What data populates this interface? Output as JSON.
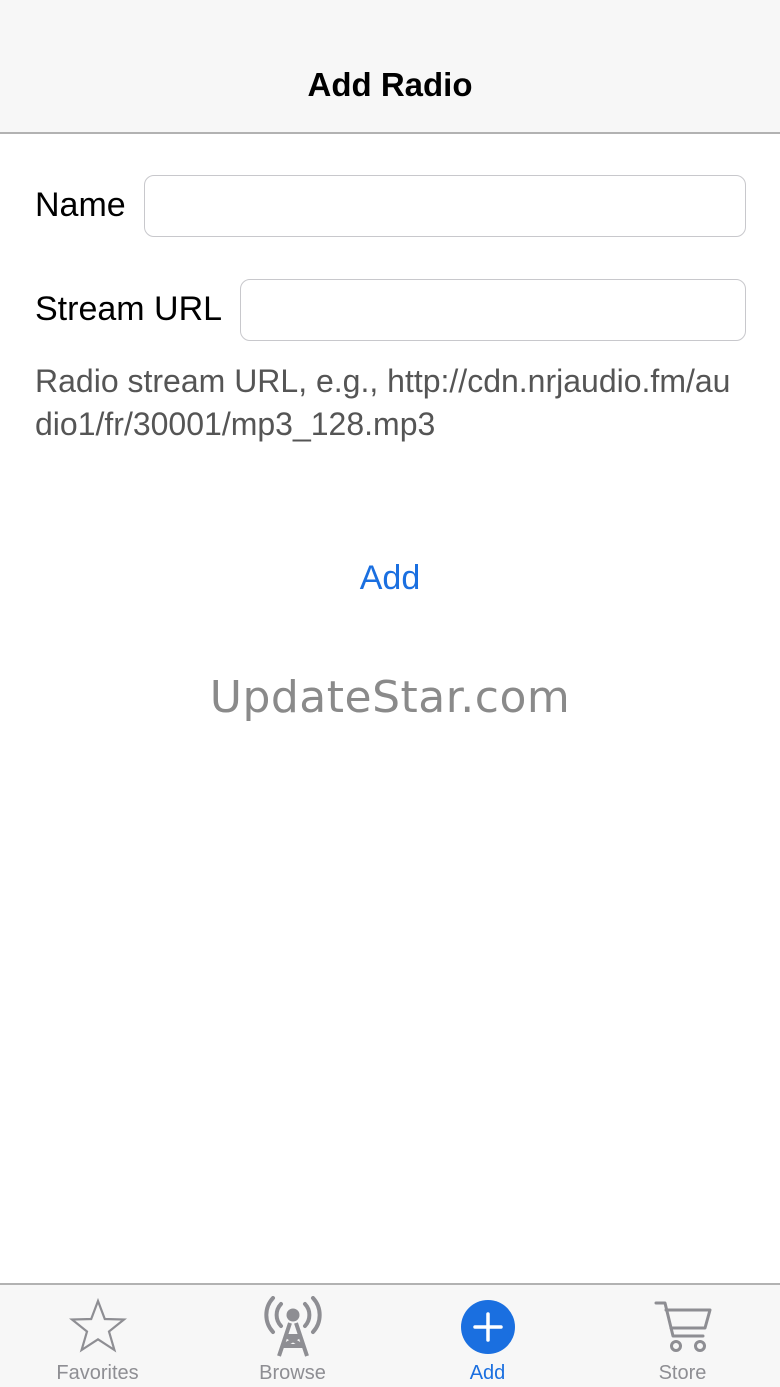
{
  "navbar": {
    "title": "Add Radio"
  },
  "form": {
    "name_label": "Name",
    "name_value": "",
    "url_label": "Stream URL",
    "url_value": "",
    "hint": "Radio stream URL, e.g., http://cdn.nrjaudio.fm/audio1/fr/30001/mp3_128.mp3",
    "add_label": "Add"
  },
  "watermark": "UpdateStar.com",
  "tabbar": {
    "items": [
      {
        "label": "Favorites",
        "icon": "star-icon",
        "active": false
      },
      {
        "label": "Browse",
        "icon": "radio-tower-icon",
        "active": false
      },
      {
        "label": "Add",
        "icon": "plus-circle-icon",
        "active": true
      },
      {
        "label": "Store",
        "icon": "cart-icon",
        "active": false
      }
    ]
  },
  "colors": {
    "accent": "#1a6fe0",
    "inactive": "#8e8e93",
    "bar_background": "#f7f7f7"
  }
}
